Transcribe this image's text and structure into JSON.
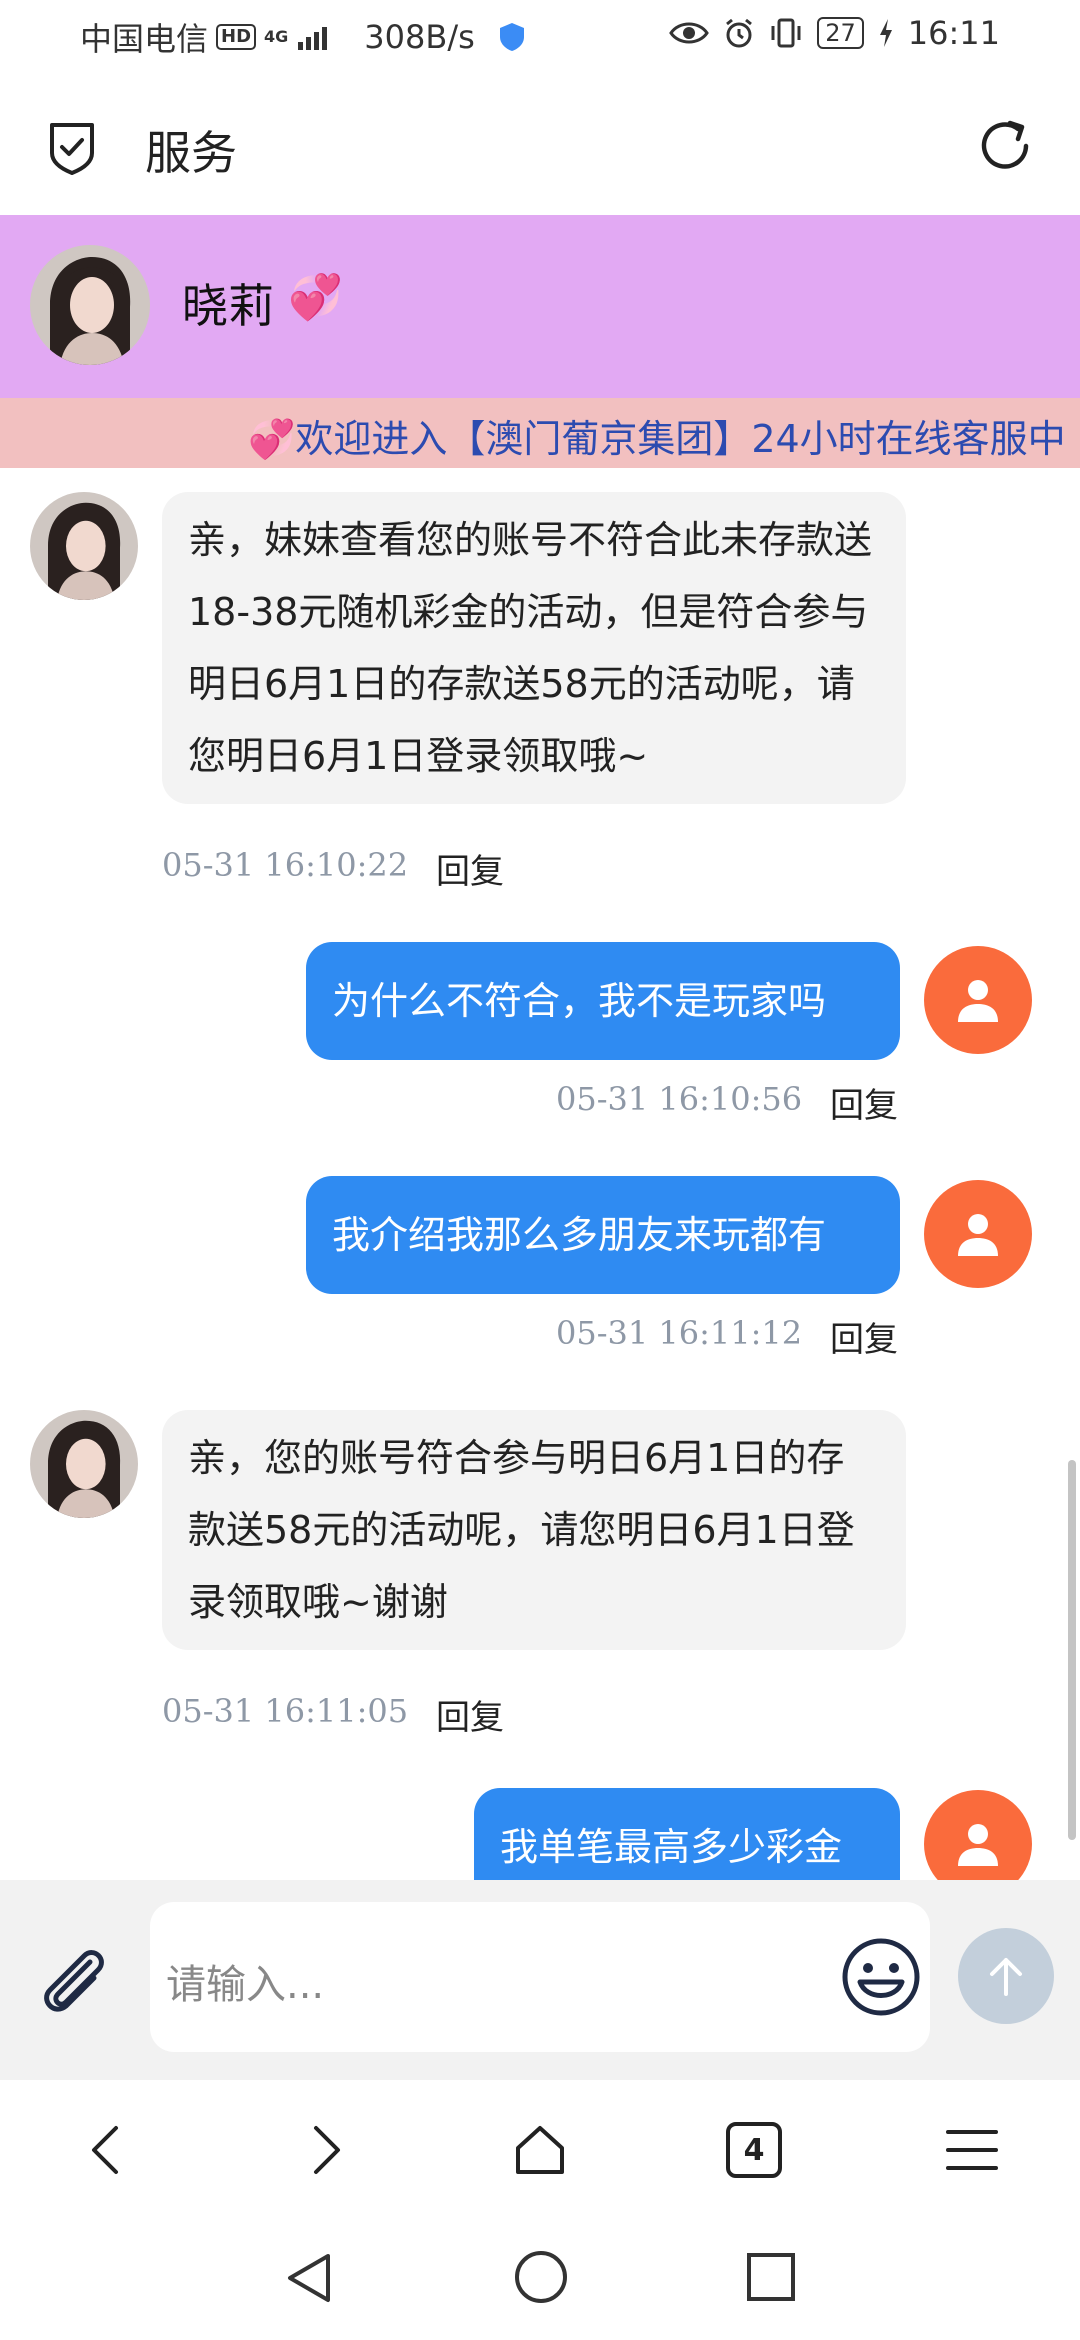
{
  "status_bar": {
    "carrier": "中国电信",
    "hd": "HD",
    "network": "4G",
    "speed": "308B/s",
    "battery": "27",
    "time": "16:11"
  },
  "header": {
    "title": "服务"
  },
  "contact": {
    "name": "晓莉",
    "heart": "💞"
  },
  "marquee": {
    "text": "💞欢迎进入【澳门葡京集团】24小时在线客服中"
  },
  "messages": [
    {
      "side": "in",
      "text": "亲，妹妹查看您的账号不符合此未存款送18-38元随机彩金的活动，但是符合参与明日6月1日的存款送58元的活动呢，请您明日6月1日登录领取哦~",
      "time": "05-31 16:10:22",
      "reply": "回复"
    },
    {
      "side": "out",
      "text": "为什么不符合，我不是玩家吗",
      "time": "05-31 16:10:56",
      "reply": "回复"
    },
    {
      "side": "out",
      "text": "我介绍我那么多朋友来玩都有",
      "time": "05-31 16:11:12",
      "reply": "回复"
    },
    {
      "side": "in",
      "text": "亲，您的账号符合参与明日6月1日的存款送58元的活动呢，请您明日6月1日登录领取哦~谢谢",
      "time": "05-31 16:11:05",
      "reply": "回复"
    },
    {
      "side": "out",
      "text": "我单笔最高多少彩金"
    }
  ],
  "input": {
    "placeholder": "请输入..."
  },
  "browser_nav": {
    "tabs_count": "4"
  },
  "colors": {
    "contact_bg": "#e2a9f3",
    "marquee_bg": "#f2c0c0",
    "bubble_out": "#2f8bf2",
    "bubble_in": "#f3f3f3",
    "user_avatar": "#fa6b3c",
    "marquee_text": "#2c4bb0"
  }
}
